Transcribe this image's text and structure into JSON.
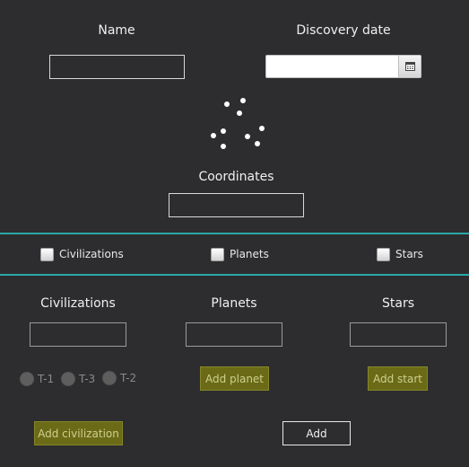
{
  "discovery": {
    "name_label": "Name",
    "name_value": "",
    "date_label": "Discovery date",
    "date_value": "",
    "coordinates_label": "Coordinates",
    "coordinates_value": "",
    "calendar_icon": "calendar-icon",
    "loading_icon": "loading-spinner-icon"
  },
  "filters": {
    "civilizations_label": "Civilizations",
    "planets_label": "Planets",
    "stars_label": "Stars",
    "civilizations_checked": false,
    "planets_checked": false,
    "stars_checked": false
  },
  "civilizations": {
    "title": "Civilizations",
    "input_value": "",
    "radio_options": [
      "T-1",
      "T-3",
      "T-2"
    ],
    "add_label": "Add civilization"
  },
  "planets": {
    "title": "Planets",
    "input_value": "",
    "add_label": "Add planet"
  },
  "stars": {
    "title": "Stars",
    "input_value": "",
    "add_label": "Add start"
  },
  "add_button_label": "Add",
  "colors": {
    "background": "#2d2d2f",
    "divider": "#2aa9a7",
    "olive_button": "#6a6a17",
    "olive_text": "#cfcf8e"
  }
}
